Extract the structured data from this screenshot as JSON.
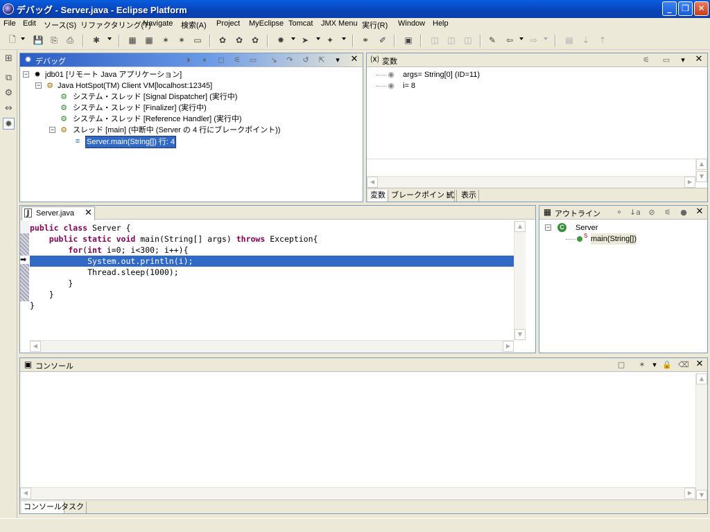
{
  "window": {
    "title": "デバッグ - Server.java - Eclipse Platform"
  },
  "menu": [
    "File",
    "Edit",
    "ソース(S)",
    "リファクタリング(T)",
    "Navigate",
    "検索(A)",
    "Project",
    "MyEclipse",
    "Tomcat",
    "JMX Menu",
    "実行(R)",
    "Window",
    "Help"
  ],
  "debug_view": {
    "title": "デバッグ",
    "tree": [
      {
        "label": "jdb01 [リモート Java アプリケーション]"
      },
      {
        "label": "Java HotSpot(TM) Client VM[localhost:12345]"
      },
      {
        "label": "システム・スレッド [Signal Dispatcher] (実行中)"
      },
      {
        "label": "システム・スレッド [Finalizer] (実行中)"
      },
      {
        "label": "システム・スレッド [Reference Handler] (実行中)"
      },
      {
        "label": "スレッド [main] (中断中 (Server の 4 行にブレークポイント))"
      },
      {
        "label": "Server.main(String[]) 行: 4"
      }
    ]
  },
  "variables_view": {
    "title": "変数",
    "items": [
      {
        "text": "args= String[0]  (ID=11)"
      },
      {
        "text": "i= 8"
      }
    ],
    "tabs": [
      "変数",
      "ブレークポイント",
      "式",
      "表示"
    ]
  },
  "editor": {
    "tab": "Server.java",
    "lines": [
      {
        "kw": "public class",
        "rest": " Server {"
      },
      {
        "indent": "    ",
        "kw": "public static void",
        "rest": " main(String[] args) ",
        "kw2": "throws",
        "rest2": " Exception{"
      },
      {
        "indent": "        ",
        "kw": "for",
        "rest": "(",
        "kw2": "int",
        "rest2": " i=0; i<300; i++){"
      },
      {
        "indent": "            ",
        "rest": "System.out.println(i);"
      },
      {
        "indent": "            ",
        "rest": "Thread.sleep(1000);"
      },
      {
        "indent": "        ",
        "rest": "}"
      },
      {
        "indent": "    ",
        "rest": "}"
      },
      {
        "rest": "}"
      }
    ]
  },
  "outline_view": {
    "title": "アウトライン",
    "class_name": "Server",
    "class_badge": "C",
    "method": "main(String[])",
    "method_modifier": "S"
  },
  "console_view": {
    "title": "コンソール",
    "tabs": [
      "コンソール",
      "タスク"
    ]
  },
  "colors": {
    "keyword": "#7f0055",
    "selection": "#316ac5",
    "title_bar": "#0a5ddf"
  },
  "icons": {
    "debug": "bug-icon",
    "thread": "gear-icon",
    "stack_frame": "stack-frame-icon",
    "current_line": "arrow-right-icon"
  }
}
